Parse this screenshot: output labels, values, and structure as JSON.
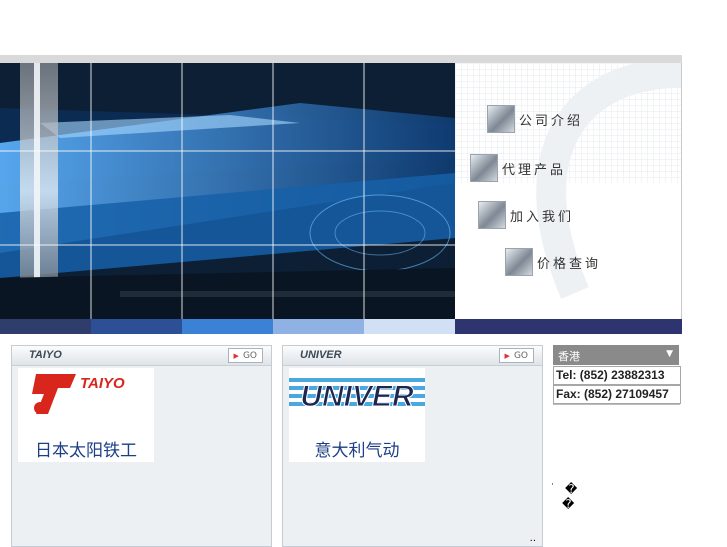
{
  "menu": {
    "items": [
      {
        "label": "公司介绍"
      },
      {
        "label": "代理产品"
      },
      {
        "label": "加入我们"
      },
      {
        "label": "价格查询"
      }
    ]
  },
  "brands": [
    {
      "title": "TAIYO",
      "go_label": "GO",
      "logo_text": "TAIYO",
      "name": "日本太阳铁工"
    },
    {
      "title": "UNIVER",
      "go_label": "GO",
      "logo_text": "UNIVER",
      "name": "意大利气动"
    }
  ],
  "contact": {
    "region": "香港",
    "tel": "Tel: (852) 23882313",
    "fax": "Fax: (852) 27109457"
  },
  "misc": {
    "glyph1": "�",
    "glyph2": "�",
    "dot": "·",
    "dots": ".."
  },
  "colors": {
    "strip": [
      "#2f3d6c",
      "#2d4f96",
      "#3b82d6",
      "#8fb1e4",
      "#d2e0f5",
      "#2d3470"
    ]
  }
}
